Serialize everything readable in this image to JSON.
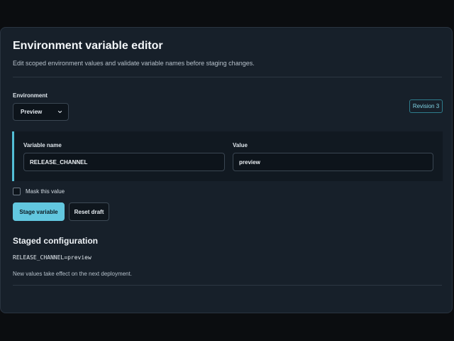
{
  "header": {
    "title": "Environment variable editor",
    "subtitle": "Edit scoped environment values and validate variable names before staging changes."
  },
  "environment": {
    "label": "Environment",
    "selected": "Preview",
    "revision": "Revision 3"
  },
  "variable": {
    "name_label": "Variable name",
    "name_value": "RELEASE_CHANNEL",
    "value_label": "Value",
    "value_value": "preview"
  },
  "mask": {
    "label": "Mask this value",
    "checked": false
  },
  "actions": {
    "stage_label": "Stage variable",
    "reset_label": "Reset draft"
  },
  "staged": {
    "title": "Staged configuration",
    "line": "RELEASE_CHANNEL=preview",
    "note": "New values take effect on the next deployment."
  },
  "colors": {
    "accent": "#62c7df",
    "card_background": "#17202a",
    "page_background": "#0b0d10"
  }
}
